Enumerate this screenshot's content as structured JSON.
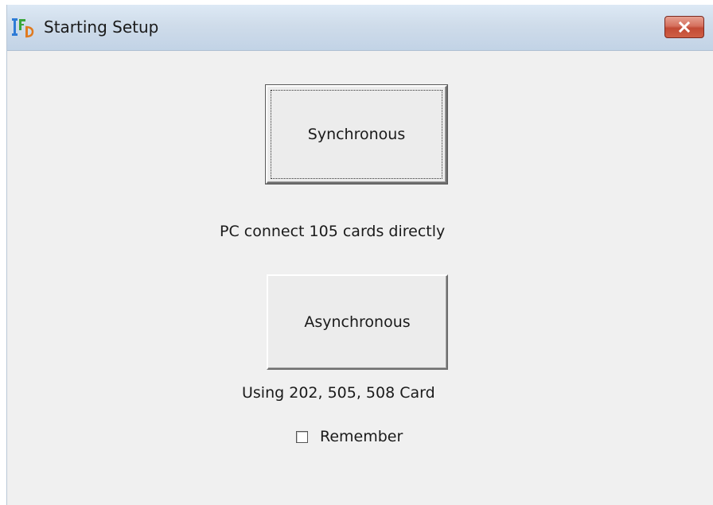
{
  "window": {
    "title": "Starting Setup",
    "app_icon": "app-logo-icon",
    "close_icon": "close-icon"
  },
  "buttons": {
    "synchronous_label": "Synchronous",
    "asynchronous_label": "Asynchronous"
  },
  "descriptions": {
    "synchronous": "PC connect 105 cards directly",
    "asynchronous": "Using 202, 505, 508 Card"
  },
  "remember": {
    "label": "Remember",
    "checked": false
  },
  "colors": {
    "titlebar": "#cfdcea",
    "close_button": "#c24a35",
    "dialog_background": "#f0f0f0"
  }
}
